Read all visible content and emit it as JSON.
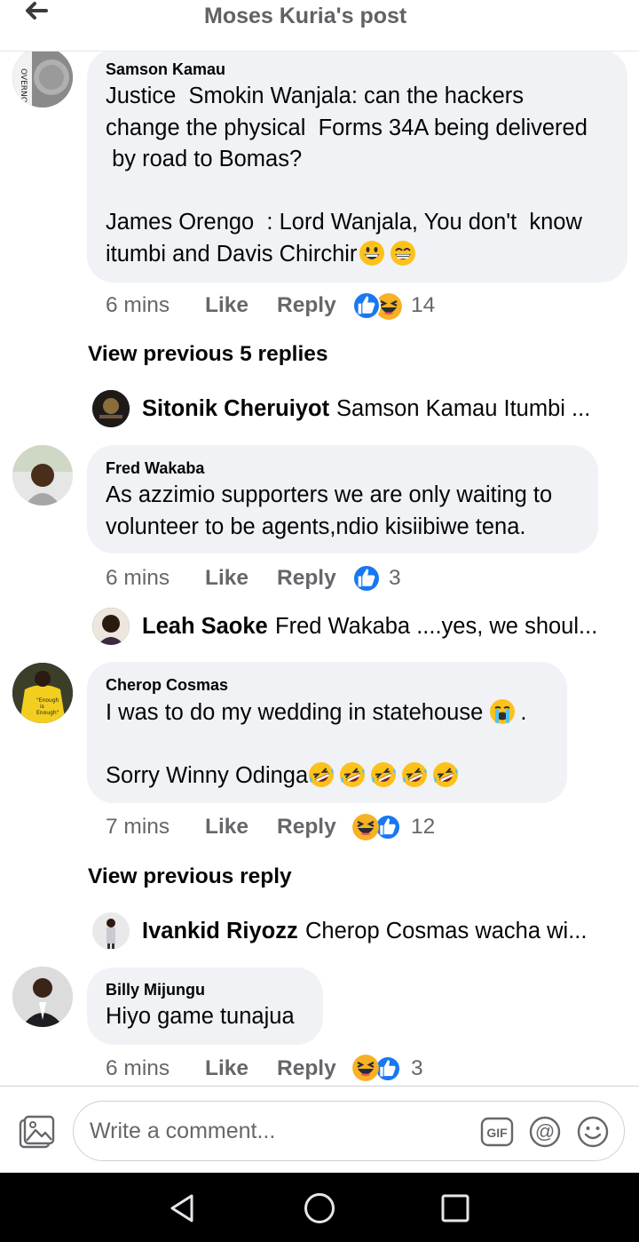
{
  "header": {
    "title": "Moses Kuria's post",
    "back_icon": "arrow-left-icon"
  },
  "comments": [
    {
      "author": "Samson Kamau",
      "text_lines": [
        "Justice  Smokin Wanjala: can the hackers",
        "change the physical  Forms 34A being delivered",
        " by road to Bomas?",
        "",
        "James Orengo  : Lord Wanjala, You don't  know",
        "itumbi and Davis Chirchir"
      ],
      "emojis": [
        "grinning-face",
        "beaming-face"
      ],
      "time": "6 mins",
      "like_label": "Like",
      "reply_label": "Reply",
      "reactions": [
        "like",
        "haha"
      ],
      "reaction_count": "14"
    },
    {
      "author": "Fred Wakaba",
      "text_lines": [
        "As azzimio supporters we are only waiting to",
        "volunteer to be agents,ndio kisiibiwe tena."
      ],
      "time": "6 mins",
      "like_label": "Like",
      "reply_label": "Reply",
      "reactions": [
        "like"
      ],
      "reaction_count": "3"
    },
    {
      "author": "Cherop Cosmas",
      "text_lines": [
        "I was to do my wedding in statehouse",
        "",
        "Sorry Winny Odinga"
      ],
      "emojis": [
        "crying-face",
        "rolling-laughing-face"
      ],
      "time": "7 mins",
      "like_label": "Like",
      "reply_label": "Reply",
      "reactions": [
        "haha",
        "like"
      ],
      "reaction_count": "12"
    },
    {
      "author": "Billy Mijungu",
      "text_lines": [
        "Hiyo game tunajua"
      ],
      "time": "6 mins",
      "like_label": "Like",
      "reply_label": "Reply",
      "reactions": [
        "haha",
        "like"
      ],
      "reaction_count": "3"
    }
  ],
  "view_previous": [
    "View previous 5 replies",
    "View previous reply"
  ],
  "replies": [
    {
      "author": "Sitonik Cheruiyot",
      "snippet": "Samson Kamau Itumbi ..."
    },
    {
      "author": "Leah Saoke",
      "snippet": "Fred Wakaba ....yes, we shoul..."
    },
    {
      "author": "Ivankid Riyozz",
      "snippet": "Cherop Cosmas wacha wi..."
    }
  ],
  "composer": {
    "placeholder": "Write a comment...",
    "tools": [
      "photo-icon",
      "gif-icon",
      "mention-icon",
      "emoji-icon"
    ]
  },
  "navbar": [
    "back-triangle-icon",
    "home-circle-icon",
    "recents-square-icon"
  ],
  "colors": {
    "like_blue": "#1877f2",
    "haha_yellow": "#f7b125",
    "bubble_gray": "#f0f2f5",
    "meta_gray": "#65676b"
  }
}
